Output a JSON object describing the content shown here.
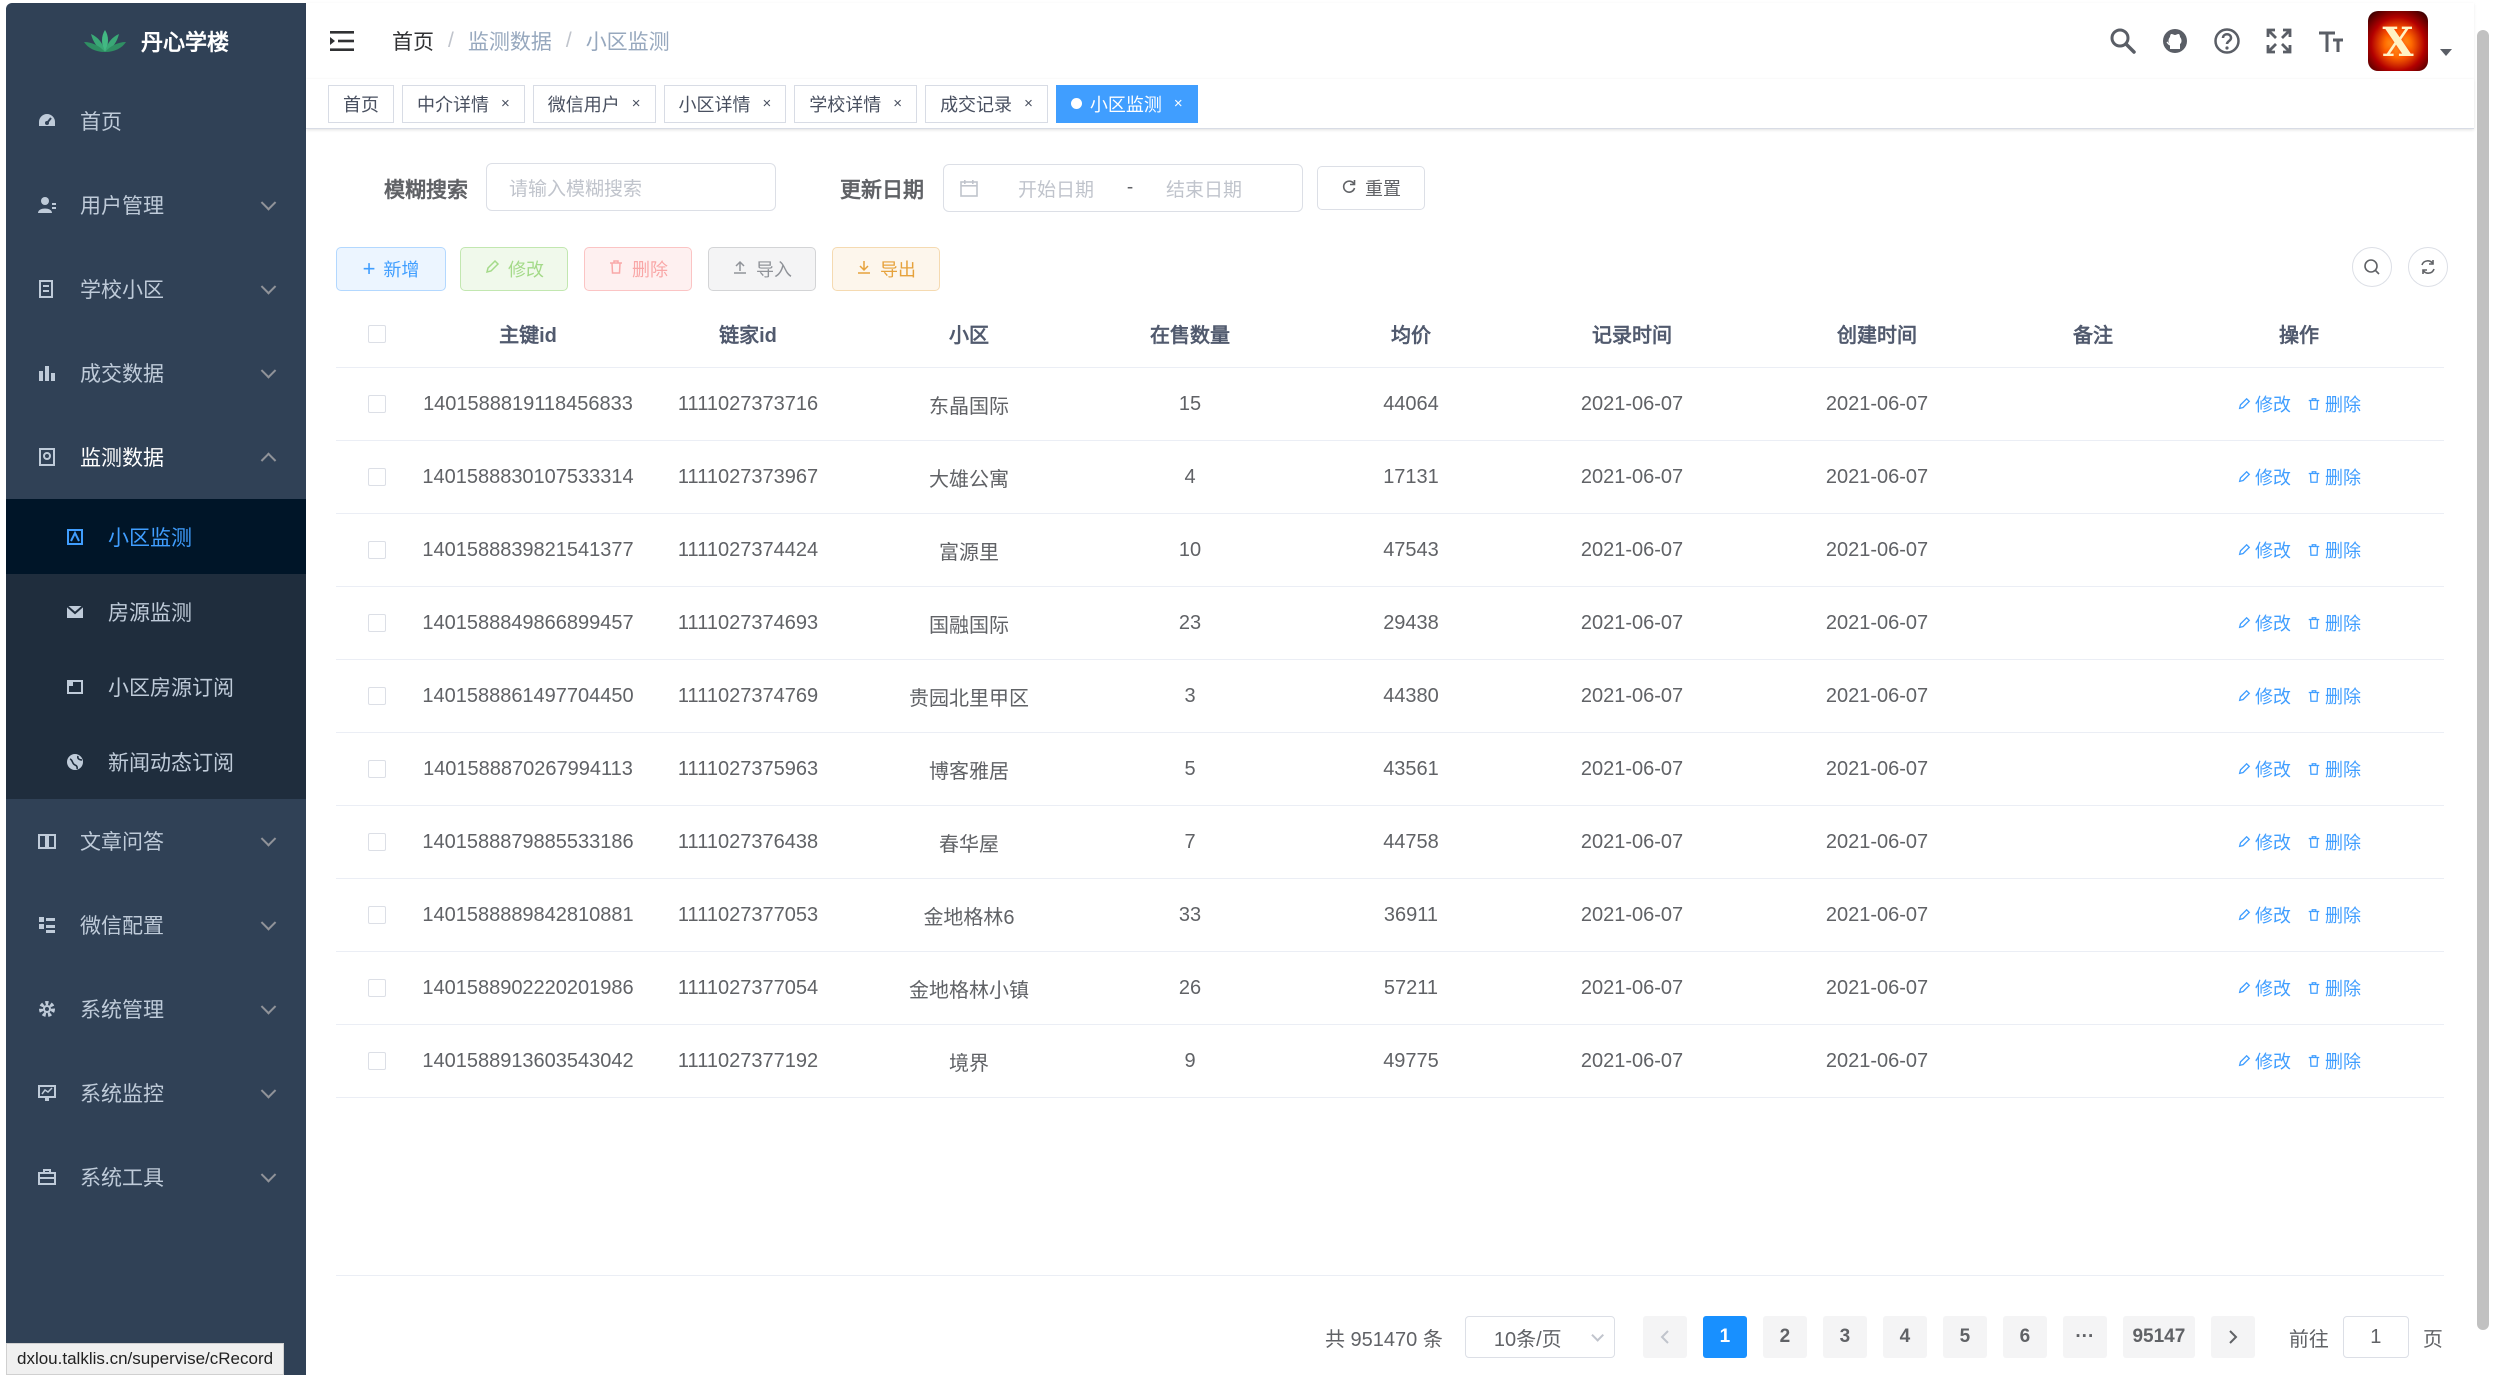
{
  "sidebar": {
    "logo_text": "丹心学楼",
    "menu": [
      {
        "label": "首页",
        "icon": "dashboard-icon"
      },
      {
        "label": "用户管理",
        "icon": "user-icon"
      },
      {
        "label": "学校小区",
        "icon": "list-icon"
      },
      {
        "label": "成交数据",
        "icon": "chart-icon"
      },
      {
        "label": "监测数据",
        "icon": "monitor-icon"
      }
    ],
    "submenu": [
      {
        "label": "小区监测",
        "icon": "community-icon"
      },
      {
        "label": "房源监测",
        "icon": "mail-icon"
      },
      {
        "label": "小区房源订阅",
        "icon": "subscribe-icon"
      },
      {
        "label": "新闻动态订阅",
        "icon": "globe-icon"
      }
    ],
    "menu_bottom": [
      {
        "label": "文章问答",
        "icon": "book-icon"
      },
      {
        "label": "微信配置",
        "icon": "wechat-config-icon"
      },
      {
        "label": "系统管理",
        "icon": "gear-icon"
      },
      {
        "label": "系统监控",
        "icon": "monitor-screen-icon"
      },
      {
        "label": "系统工具",
        "icon": "toolbox-icon"
      }
    ]
  },
  "status_url": "dxlou.talklis.cn/supervise/cRecord",
  "breadcrumb": [
    "首页",
    "监测数据",
    "小区监测"
  ],
  "tags": [
    {
      "label": "首页"
    },
    {
      "label": "中介详情"
    },
    {
      "label": "微信用户"
    },
    {
      "label": "小区详情"
    },
    {
      "label": "学校详情"
    },
    {
      "label": "成交记录"
    },
    {
      "label": "小区监测"
    }
  ],
  "search": {
    "fuzzy_label": "模糊搜索",
    "fuzzy_placeholder": "请输入模糊搜索",
    "date_label": "更新日期",
    "start_placeholder": "开始日期",
    "range_sep": "-",
    "end_placeholder": "结束日期",
    "reset_label": "重置"
  },
  "toolbar": {
    "add": "新增",
    "edit": "修改",
    "delete": "删除",
    "import": "导入",
    "export": "导出"
  },
  "table": {
    "columns": [
      "主键id",
      "链家id",
      "小区",
      "在售数量",
      "均价",
      "记录时间",
      "创建时间",
      "备注",
      "操作"
    ],
    "edit_label": "修改",
    "delete_label": "删除",
    "rows": [
      {
        "id": "1401588819118456833",
        "lianjia_id": "1111027373716",
        "community": "东晶国际",
        "on_sale": "15",
        "avg_price": "44064",
        "record_time": "2021-06-07",
        "create_time": "2021-06-07",
        "remark": ""
      },
      {
        "id": "1401588830107533314",
        "lianjia_id": "1111027373967",
        "community": "大雄公寓",
        "on_sale": "4",
        "avg_price": "17131",
        "record_time": "2021-06-07",
        "create_time": "2021-06-07",
        "remark": ""
      },
      {
        "id": "1401588839821541377",
        "lianjia_id": "1111027374424",
        "community": "富源里",
        "on_sale": "10",
        "avg_price": "47543",
        "record_time": "2021-06-07",
        "create_time": "2021-06-07",
        "remark": ""
      },
      {
        "id": "1401588849866899457",
        "lianjia_id": "1111027374693",
        "community": "国融国际",
        "on_sale": "23",
        "avg_price": "29438",
        "record_time": "2021-06-07",
        "create_time": "2021-06-07",
        "remark": ""
      },
      {
        "id": "1401588861497704450",
        "lianjia_id": "1111027374769",
        "community": "贵园北里甲区",
        "on_sale": "3",
        "avg_price": "44380",
        "record_time": "2021-06-07",
        "create_time": "2021-06-07",
        "remark": ""
      },
      {
        "id": "1401588870267994113",
        "lianjia_id": "1111027375963",
        "community": "博客雅居",
        "on_sale": "5",
        "avg_price": "43561",
        "record_time": "2021-06-07",
        "create_time": "2021-06-07",
        "remark": ""
      },
      {
        "id": "1401588879885533186",
        "lianjia_id": "1111027376438",
        "community": "春华屋",
        "on_sale": "7",
        "avg_price": "44758",
        "record_time": "2021-06-07",
        "create_time": "2021-06-07",
        "remark": ""
      },
      {
        "id": "1401588889842810881",
        "lianjia_id": "1111027377053",
        "community": "金地格林6",
        "on_sale": "33",
        "avg_price": "36911",
        "record_time": "2021-06-07",
        "create_time": "2021-06-07",
        "remark": ""
      },
      {
        "id": "1401588902220201986",
        "lianjia_id": "1111027377054",
        "community": "金地格林小镇",
        "on_sale": "26",
        "avg_price": "57211",
        "record_time": "2021-06-07",
        "create_time": "2021-06-07",
        "remark": ""
      },
      {
        "id": "1401588913603543042",
        "lianjia_id": "1111027377192",
        "community": "境界",
        "on_sale": "9",
        "avg_price": "49775",
        "record_time": "2021-06-07",
        "create_time": "2021-06-07",
        "remark": ""
      }
    ]
  },
  "pagination": {
    "total_text": "共 951470 条",
    "page_size": "10条/页",
    "pages": [
      "1",
      "2",
      "3",
      "4",
      "5",
      "6"
    ],
    "ellipsis": "···",
    "last_page": "95147",
    "current": "1",
    "goto_label": "前往",
    "goto_value": "1",
    "page_unit": "页"
  },
  "colors": {
    "sidebar_bg": "#304156",
    "submenu_bg": "#1f2d3d",
    "primary": "#409eff"
  }
}
